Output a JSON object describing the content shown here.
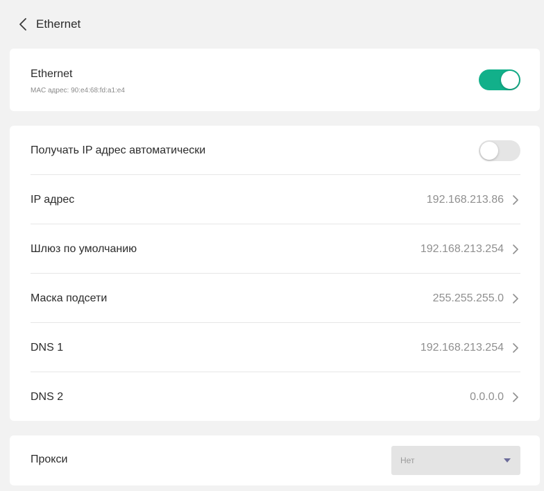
{
  "colors": {
    "accent": "#12b08a",
    "background": "#f2f2f2",
    "card": "#ffffff"
  },
  "header": {
    "title": "Ethernet",
    "back_icon": "chevron-left-icon"
  },
  "ethernet": {
    "title": "Ethernet",
    "mac": "MAC адрес: 90:e4:68:fd:a1:e4",
    "enabled": true
  },
  "settings": {
    "auto_ip": {
      "label": "Получать IP адрес автоматически",
      "enabled": false
    },
    "rows": [
      {
        "label": "IP адрес",
        "value": "192.168.213.86"
      },
      {
        "label": "Шлюз по умолчанию",
        "value": "192.168.213.254"
      },
      {
        "label": "Маска подсети",
        "value": "255.255.255.0"
      },
      {
        "label": "DNS 1",
        "value": "192.168.213.254"
      },
      {
        "label": "DNS 2",
        "value": "0.0.0.0"
      }
    ]
  },
  "proxy": {
    "label": "Прокси",
    "selected": "Нет"
  }
}
